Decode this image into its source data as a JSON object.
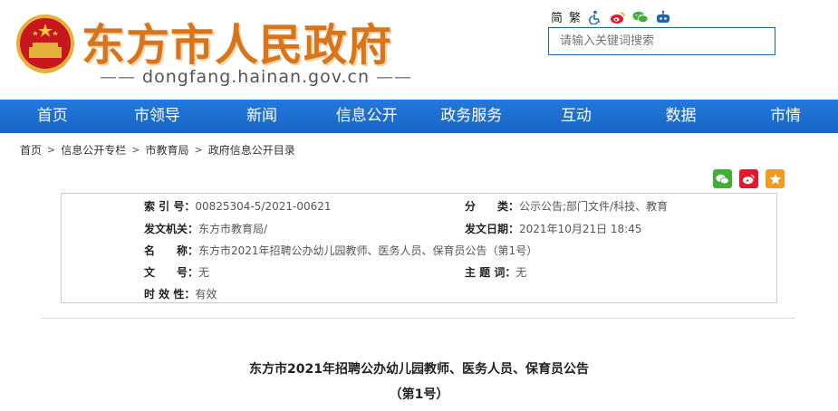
{
  "header": {
    "title": "东方市人民政府",
    "domain": "dongfang.hainan.gov.cn",
    "dash_left": "—— ",
    "dash_right": " ——",
    "lang_simplified": "简",
    "lang_traditional": "繁",
    "icons": [
      "accessibility-icon",
      "weibo-icon",
      "wechat-icon",
      "robot-icon"
    ],
    "search_placeholder": "请输入关键词搜索"
  },
  "nav": {
    "items": [
      "首页",
      "市领导",
      "新闻",
      "信息公开",
      "政务服务",
      "互动",
      "数据",
      "市情"
    ]
  },
  "breadcrumb": {
    "items": [
      "首页",
      "信息公开专栏",
      "市教育局",
      "政府信息公开目录"
    ],
    "separator": ">"
  },
  "info": {
    "index_label": "索 引 号：",
    "index_value": "00825304-5/2021-00621",
    "category_label": "分　　类：",
    "category_value": "公示公告;部门文件/科技、教育",
    "issuer_label": "发文机关：",
    "issuer_value": "东方市教育局/",
    "date_label": "发文日期：",
    "date_value": "2021年10月21日  18:45",
    "name_label": "名　　称：",
    "name_value": "东方市2021年招聘公办幼儿园教师、医务人员、保育员公告（第1号）",
    "docno_label": "文　　号：",
    "docno_value": "无",
    "subject_label": "主 题 词：",
    "subject_value": "无",
    "validity_label": "时 效 性：",
    "validity_value": "有效"
  },
  "article": {
    "title": "东方市2021年招聘公办幼儿园教师、医务人员、保育员公告",
    "subtitle": "（第1号）"
  },
  "colors": {
    "nav_blue": "#1e6fd0",
    "title_orange": "#d8751b",
    "wechat_green": "#3eb135",
    "weibo_red": "#e6162d",
    "star_orange": "#f29a1a"
  }
}
